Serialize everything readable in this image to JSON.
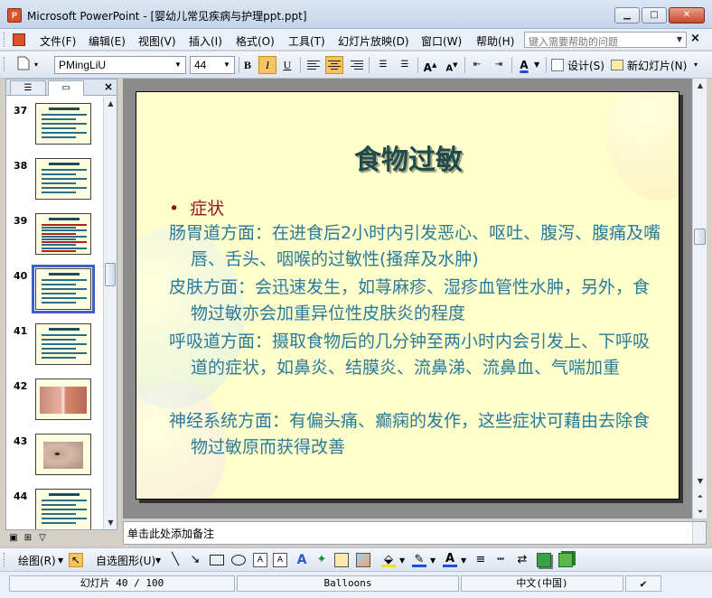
{
  "window": {
    "title": "Microsoft PowerPoint - [婴幼儿常见疾病与护理ppt.ppt]",
    "app_icon": "powerpoint-icon",
    "controls": {
      "minimize": "▁",
      "maximize": "□",
      "close": "✕"
    }
  },
  "menu": {
    "items": [
      "文件(F)",
      "编辑(E)",
      "视图(V)",
      "插入(I)",
      "格式(O)",
      "工具(T)",
      "幻灯片放映(D)",
      "窗口(W)",
      "帮助(H)"
    ],
    "help_placeholder": "键入需要帮助的问题",
    "doc_close": "×"
  },
  "toolbar": {
    "font_name": "PMingLiU",
    "font_size": "44",
    "bold": "B",
    "italic": "I",
    "underline": "U",
    "increase_font": "A",
    "decrease_font": "A",
    "font_color": "A",
    "design_label": "设计(S)",
    "new_slide_label": "新幻灯片(N)"
  },
  "left_panel": {
    "close": "×",
    "thumbnails": [
      {
        "num": "37",
        "kind": "text"
      },
      {
        "num": "38",
        "kind": "text"
      },
      {
        "num": "39",
        "kind": "dense"
      },
      {
        "num": "40",
        "kind": "text",
        "selected": true
      },
      {
        "num": "41",
        "kind": "text"
      },
      {
        "num": "42",
        "kind": "photo"
      },
      {
        "num": "43",
        "kind": "photo"
      },
      {
        "num": "44",
        "kind": "text"
      }
    ]
  },
  "slide": {
    "title": "食物过敏",
    "bullet": "症状",
    "paragraphs": [
      "肠胃道方面：在进食后2小时内引发恶心、呕吐、腹泻、腹痛及嘴唇、舌头、咽喉的过敏性(搔痒及水肿)",
      "皮肤方面：会迅速发生，如荨麻疹、湿疹血管性水肿，另外，食物过敏亦会加重异位性皮肤炎的程度",
      "呼吸道方面：摄取食物后的几分钟至两小时内会引发上、下呼吸道的症状，如鼻炎、结膜炎、流鼻涕、流鼻血、气喘加重",
      "神经系统方面：有偏头痛、癫痫的发作，这些症状可藉由去除食物过敏原而获得改善"
    ]
  },
  "notes": {
    "placeholder": "单击此处添加备注"
  },
  "drawbar": {
    "draw_label": "绘图(R)",
    "autoshape_label": "自选图形(U)"
  },
  "status": {
    "slide_position": "幻灯片 40 / 100",
    "template": "Balloons",
    "language": "中文(中国)"
  },
  "colors": {
    "slide_bg": "#ffffcc",
    "title_color": "#1e4b4f",
    "bullet_color": "#8b1a1a",
    "body_color": "#2a7a9a",
    "selection": "#3b62c4"
  }
}
